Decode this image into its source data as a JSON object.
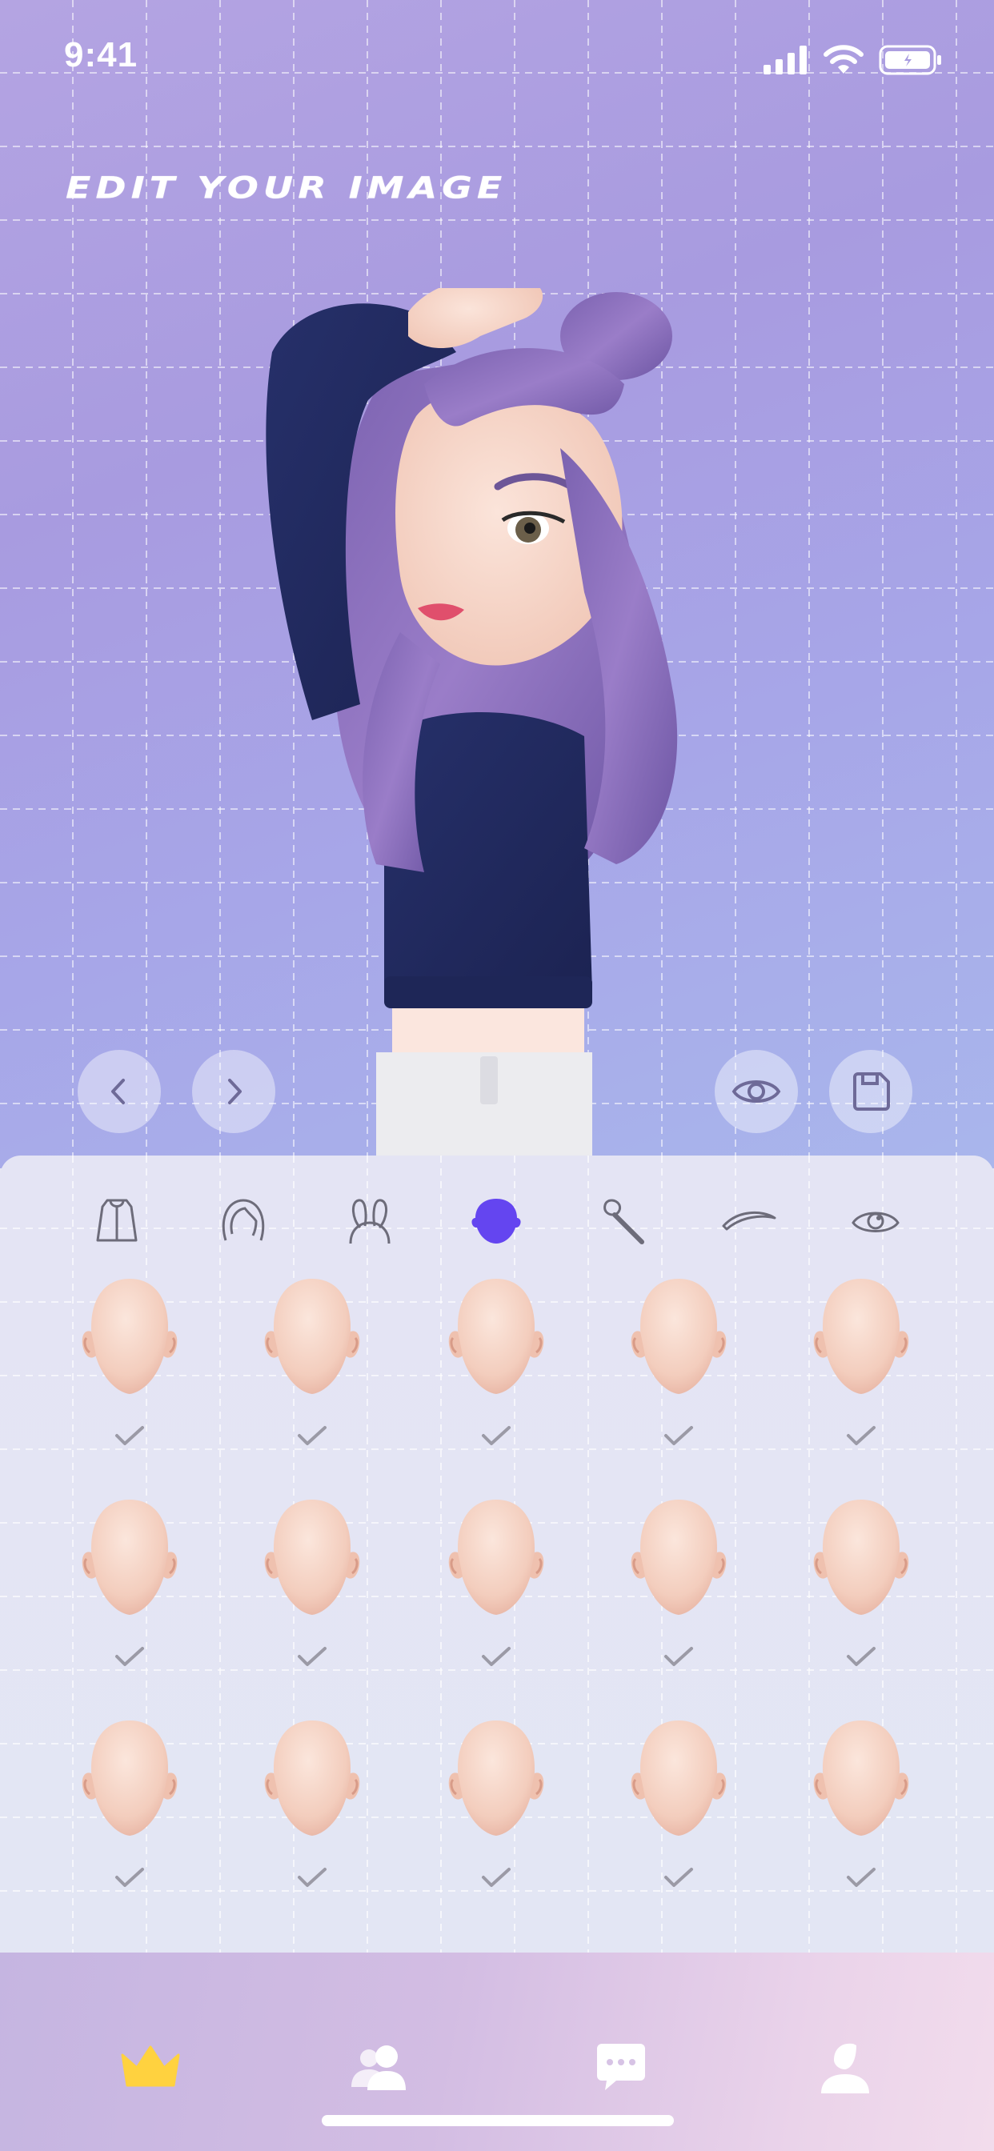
{
  "status_bar": {
    "time": "9:41"
  },
  "header": {
    "title": "EDIT YOUR IMAGE"
  },
  "colors": {
    "accent": "#6445f0",
    "crown": "#ffd23f",
    "icon_stroke": "#6d6c7a"
  },
  "controls": {
    "prev_icon": "chevron-left-icon",
    "next_icon": "chevron-right-icon",
    "preview_icon": "eye-icon",
    "save_icon": "floppy-disk-icon"
  },
  "categories": [
    {
      "name": "clothes",
      "icon": "jacket-icon",
      "selected": false
    },
    {
      "name": "hair",
      "icon": "hair-icon",
      "selected": false
    },
    {
      "name": "accessories",
      "icon": "bunny-ears-icon",
      "selected": false
    },
    {
      "name": "face shape",
      "icon": "face-shape-icon",
      "selected": true
    },
    {
      "name": "makeup",
      "icon": "makeup-brush-icon",
      "selected": false
    },
    {
      "name": "eyebrows",
      "icon": "eyebrow-icon",
      "selected": false
    },
    {
      "name": "eyes",
      "icon": "eye-icon",
      "selected": false
    }
  ],
  "face_options_rows": 3,
  "face_options_cols": 5,
  "tabs": [
    {
      "name": "home",
      "icon": "crown-icon",
      "active": true
    },
    {
      "name": "friends",
      "icon": "people-icon",
      "active": false
    },
    {
      "name": "messages",
      "icon": "chat-icon",
      "active": false
    },
    {
      "name": "profile",
      "icon": "person-icon",
      "active": false
    }
  ]
}
